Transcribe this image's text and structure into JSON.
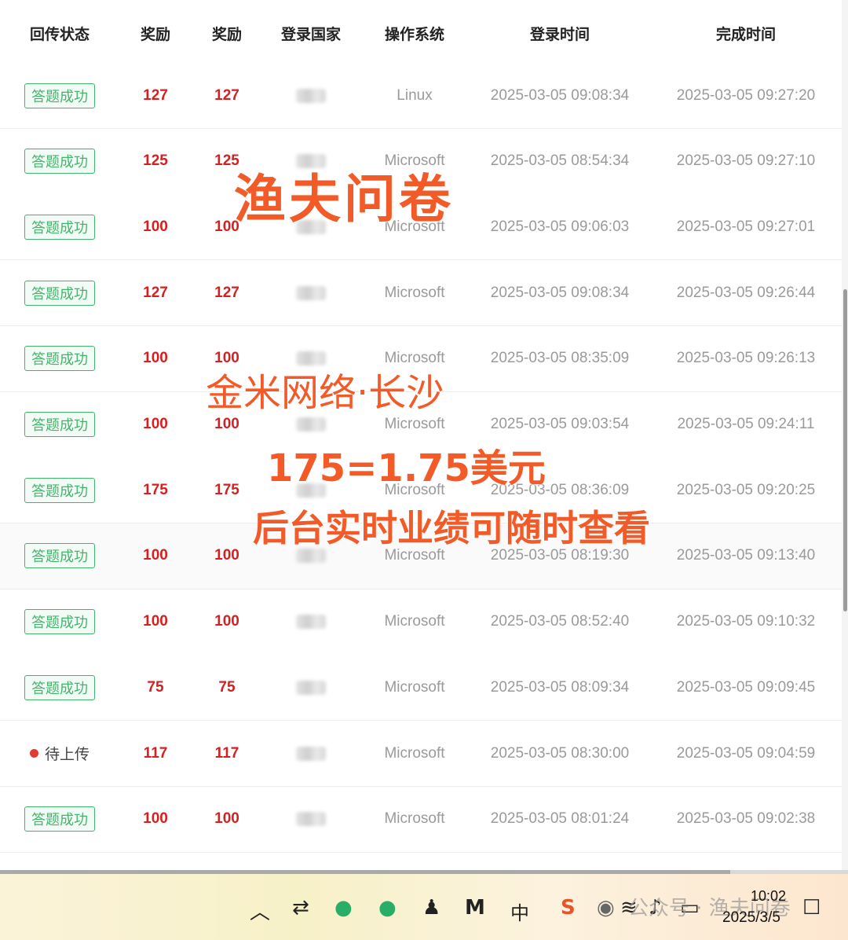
{
  "table": {
    "headers": [
      "回传状态",
      "奖励",
      "奖励",
      "登录国家",
      "操作系统",
      "登录时间",
      "完成时间"
    ],
    "rows": [
      {
        "status": "答题成功",
        "status_type": "success",
        "reward1": "127",
        "reward2": "127",
        "os": "Linux",
        "login": "2025-03-05 09:08:34",
        "done": "2025-03-05 09:27:20"
      },
      {
        "status": "答题成功",
        "status_type": "success",
        "reward1": "125",
        "reward2": "125",
        "os": "Microsoft",
        "login": "2025-03-05 08:54:34",
        "done": "2025-03-05 09:27:10"
      },
      {
        "status": "答题成功",
        "status_type": "success",
        "reward1": "100",
        "reward2": "100",
        "os": "Microsoft",
        "login": "2025-03-05 09:06:03",
        "done": "2025-03-05 09:27:01"
      },
      {
        "status": "答题成功",
        "status_type": "success",
        "reward1": "127",
        "reward2": "127",
        "os": "Microsoft",
        "login": "2025-03-05 09:08:34",
        "done": "2025-03-05 09:26:44"
      },
      {
        "status": "答题成功",
        "status_type": "success",
        "reward1": "100",
        "reward2": "100",
        "os": "Microsoft",
        "login": "2025-03-05 08:35:09",
        "done": "2025-03-05 09:26:13"
      },
      {
        "status": "答题成功",
        "status_type": "success",
        "reward1": "100",
        "reward2": "100",
        "os": "Microsoft",
        "login": "2025-03-05 09:03:54",
        "done": "2025-03-05 09:24:11"
      },
      {
        "status": "答题成功",
        "status_type": "success",
        "reward1": "175",
        "reward2": "175",
        "os": "Microsoft",
        "login": "2025-03-05 08:36:09",
        "done": "2025-03-05 09:20:25"
      },
      {
        "status": "答题成功",
        "status_type": "success",
        "reward1": "100",
        "reward2": "100",
        "os": "Microsoft",
        "login": "2025-03-05 08:19:30",
        "done": "2025-03-05 09:13:40"
      },
      {
        "status": "答题成功",
        "status_type": "success",
        "reward1": "100",
        "reward2": "100",
        "os": "Microsoft",
        "login": "2025-03-05 08:52:40",
        "done": "2025-03-05 09:10:32"
      },
      {
        "status": "答题成功",
        "status_type": "success",
        "reward1": "75",
        "reward2": "75",
        "os": "Microsoft",
        "login": "2025-03-05 08:09:34",
        "done": "2025-03-05 09:09:45"
      },
      {
        "status": "待上传",
        "status_type": "pending",
        "reward1": "117",
        "reward2": "117",
        "os": "Microsoft",
        "login": "2025-03-05 08:30:00",
        "done": "2025-03-05 09:04:59"
      },
      {
        "status": "答题成功",
        "status_type": "success",
        "reward1": "100",
        "reward2": "100",
        "os": "Microsoft",
        "login": "2025-03-05 08:01:24",
        "done": "2025-03-05 09:02:38"
      }
    ]
  },
  "overlay": {
    "line1": "渔夫问卷",
    "line2": "金米网络·长沙",
    "line3": "175=1.75美元",
    "line4": "后台实时业绩可随时查看"
  },
  "taskbar": {
    "time": "10:02",
    "date": "2025/3/5",
    "ime": "中",
    "watermark": "公众号 · 渔夫问卷"
  },
  "colors": {
    "success": "#43b56b",
    "reward": "#d42020",
    "overlay": "#f25a28",
    "pending_dot": "#e23a2f"
  }
}
